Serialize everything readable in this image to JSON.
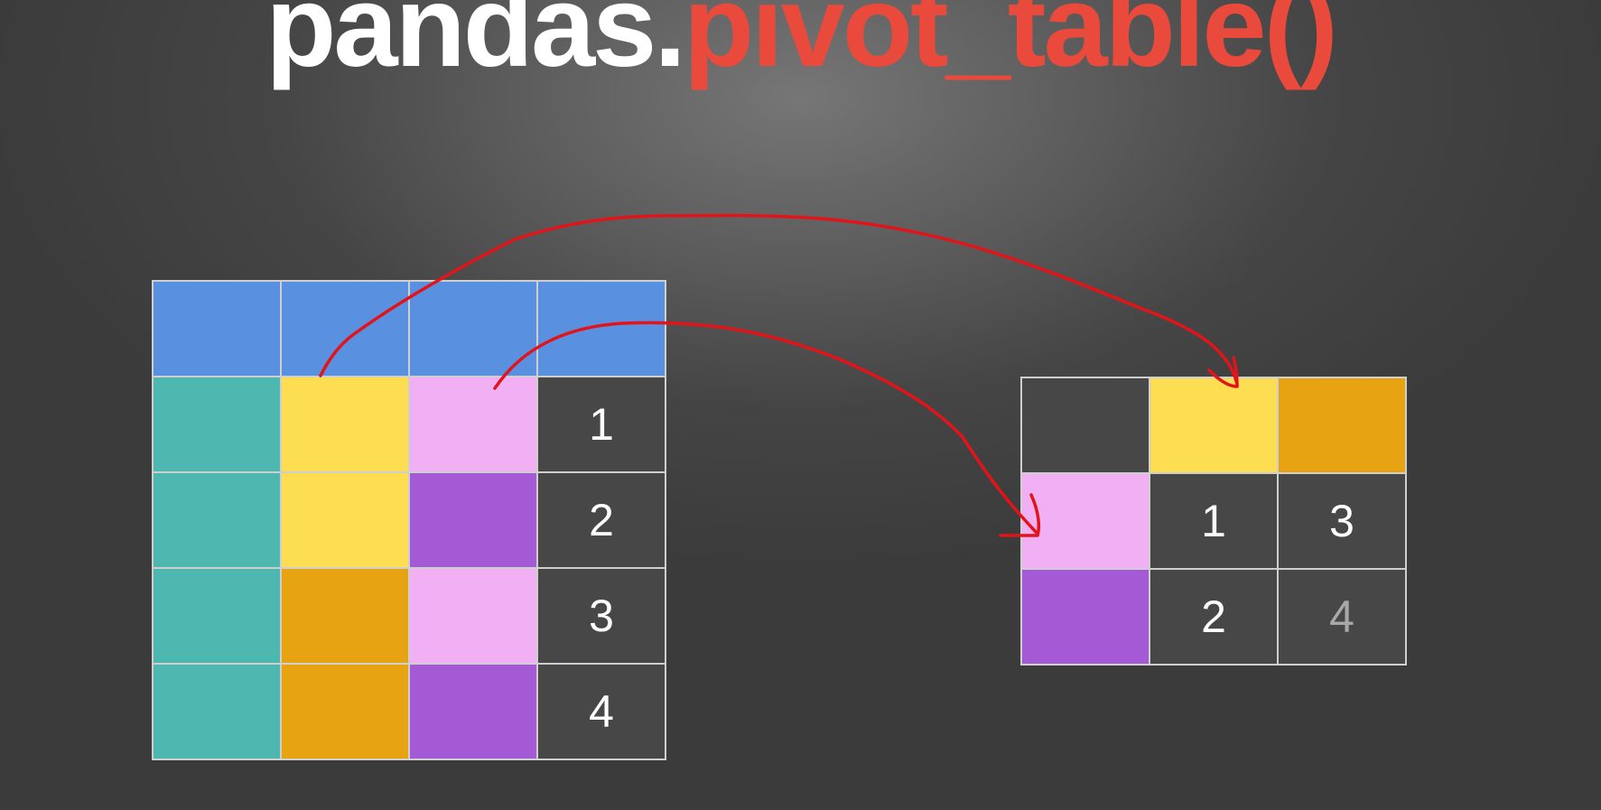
{
  "title": {
    "prefix": "pandas.",
    "function": "pivot_table()"
  },
  "colors": {
    "header": "#5990e0",
    "teal": "#4db7b0",
    "yellow": "#fddd52",
    "orange": "#e8a312",
    "pink": "#f1b0f3",
    "purple": "#a35ad4",
    "dark": "#474747",
    "arrow": "#e2141a",
    "title_accent": "#ea4a3b"
  },
  "source_table": {
    "header": [
      "",
      "",
      "",
      ""
    ],
    "rows": [
      {
        "colors": [
          "teal",
          "yellow",
          "pink"
        ],
        "value": "1"
      },
      {
        "colors": [
          "teal",
          "yellow",
          "purple"
        ],
        "value": "2"
      },
      {
        "colors": [
          "teal",
          "orange",
          "pink"
        ],
        "value": "3"
      },
      {
        "colors": [
          "teal",
          "orange",
          "purple"
        ],
        "value": "4"
      }
    ]
  },
  "pivot_table": {
    "column_headers": [
      "yellow",
      "orange"
    ],
    "rows": [
      {
        "index": "pink",
        "values": [
          "1",
          "3"
        ]
      },
      {
        "index": "purple",
        "values": [
          "2",
          "4"
        ]
      }
    ]
  },
  "arrows": [
    {
      "from": "source column 2",
      "to": "pivot columns"
    },
    {
      "from": "source column 3",
      "to": "pivot index"
    }
  ]
}
